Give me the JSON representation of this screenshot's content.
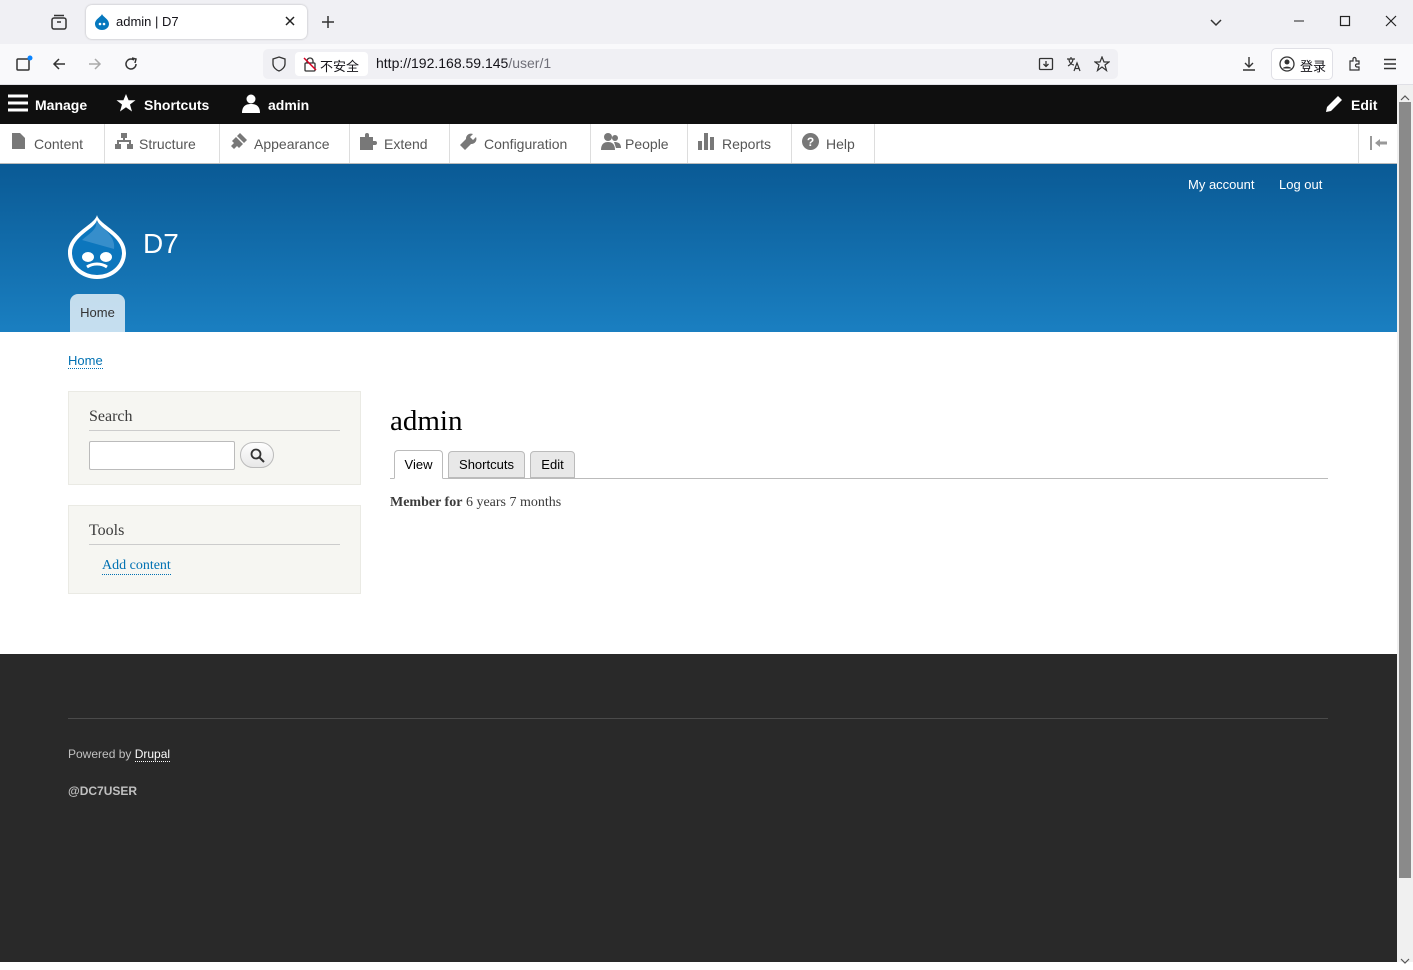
{
  "browser": {
    "tab_title": "admin | D7",
    "security_label": "不安全",
    "url_host": "http://192.168.59.145",
    "url_path": "/user/1",
    "login_label": "登录",
    "new_tab": "+",
    "icons": [
      "tab-groups-icon",
      "drupal-favicon",
      "close-tab-icon",
      "new-tab-icon",
      "list-tabs-icon",
      "minimize-icon",
      "maximize-icon",
      "close-window-icon",
      "sidebar-icon",
      "back-icon",
      "forward-icon",
      "reload-icon",
      "shield-icon",
      "insecure-lock-icon",
      "reader-icon",
      "translate-icon",
      "bookmark-star-icon",
      "download-icon",
      "account-icon",
      "extensions-icon",
      "menu-icon"
    ]
  },
  "toolbar": {
    "manage": "Manage",
    "shortcuts": "Shortcuts",
    "user": "admin",
    "edit": "Edit",
    "tray": [
      {
        "label": "Content",
        "icon": "page-icon"
      },
      {
        "label": "Structure",
        "icon": "structure-icon"
      },
      {
        "label": "Appearance",
        "icon": "brush-icon"
      },
      {
        "label": "Extend",
        "icon": "puzzle-icon"
      },
      {
        "label": "Configuration",
        "icon": "wrench-icon"
      },
      {
        "label": "People",
        "icon": "people-icon"
      },
      {
        "label": "Reports",
        "icon": "bar-chart-icon"
      },
      {
        "label": "Help",
        "icon": "help-icon"
      }
    ]
  },
  "header": {
    "my_account": "My account",
    "log_out": "Log out",
    "site_name": "D7",
    "primary_tab": "Home"
  },
  "breadcrumb": "Home",
  "sidebar": {
    "search_title": "Search",
    "search_value": "",
    "tools_title": "Tools",
    "add_content": "Add content"
  },
  "main": {
    "title": "admin",
    "tabs": [
      "View",
      "Shortcuts",
      "Edit"
    ],
    "active_tab": "View",
    "member_label": "Member for",
    "member_value": "6 years 7 months"
  },
  "footer": {
    "powered_by": "Powered by",
    "drupal": "Drupal",
    "handle": "@DC7USER"
  },
  "colors": {
    "header_top": "#0a5a95",
    "header_bottom": "#1a7fc1",
    "toolbar": "#0f0f0f",
    "footer": "#292929",
    "link": "#0071b3"
  }
}
